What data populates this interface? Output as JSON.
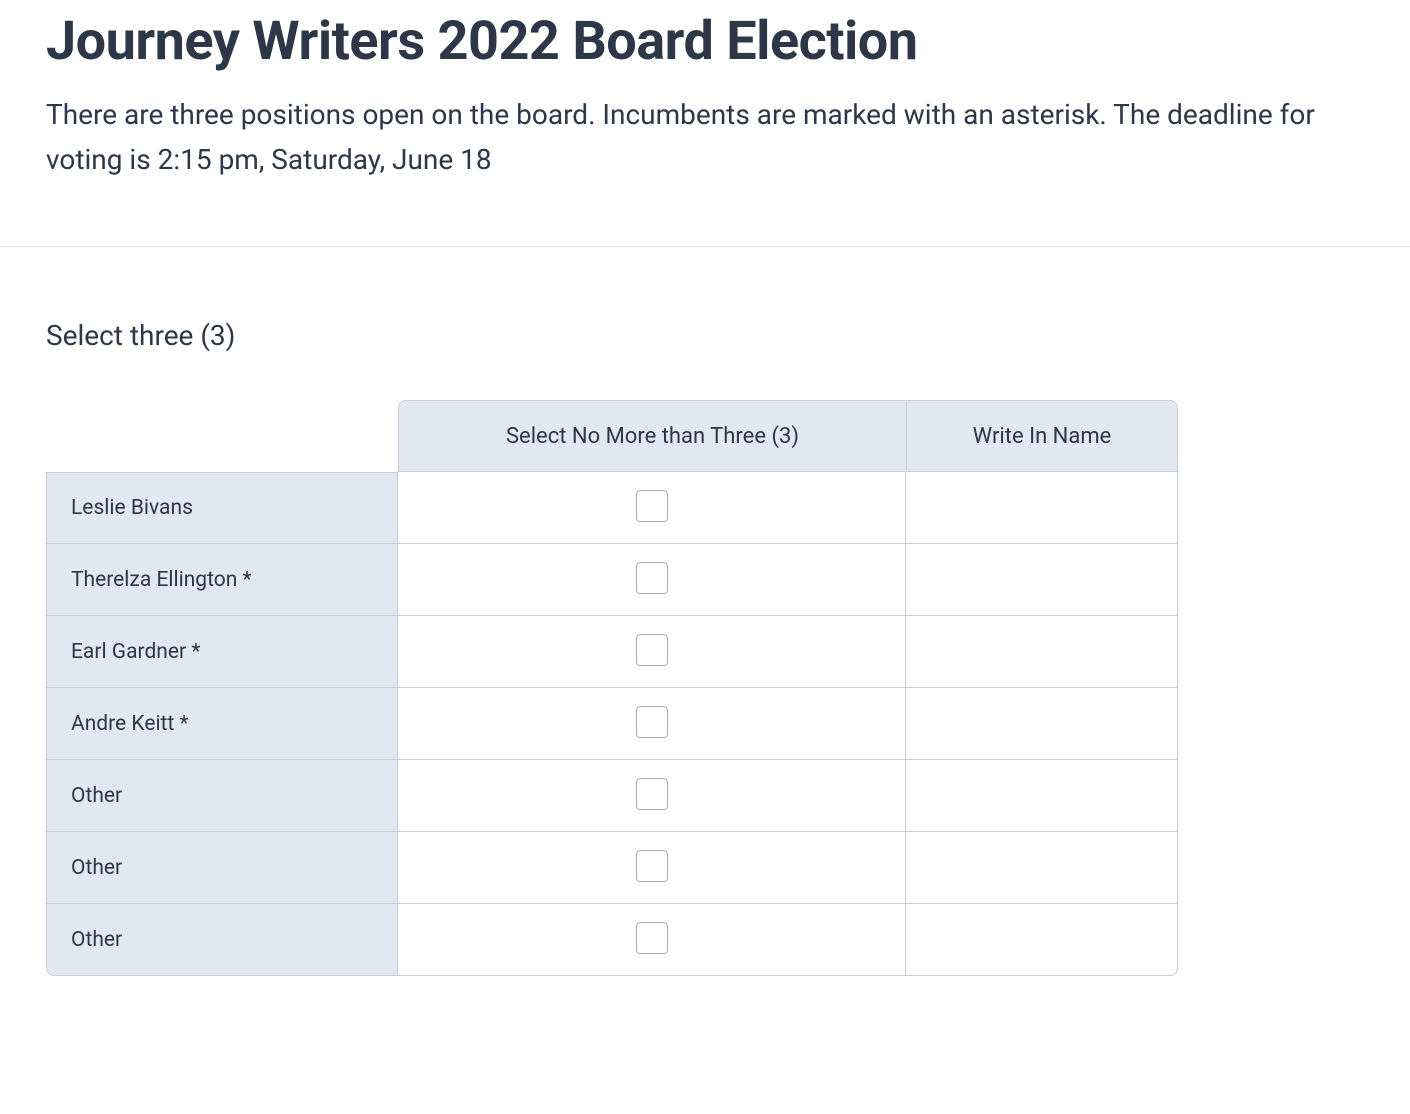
{
  "header": {
    "title": "Journey Writers 2022 Board Election",
    "description": "There are three positions open on the board. Incumbents are marked with an asterisk. The deadline for voting is 2:15 pm, Saturday, June 18"
  },
  "form": {
    "instruction": "Select three (3)",
    "columns": {
      "select": "Select No More than Three (3)",
      "writein": "Write In Name"
    },
    "rows": [
      {
        "label": "Leslie Bivans",
        "checked": false,
        "writein": ""
      },
      {
        "label": "Therelza Ellington *",
        "checked": false,
        "writein": ""
      },
      {
        "label": "Earl Gardner *",
        "checked": false,
        "writein": ""
      },
      {
        "label": "Andre Keitt *",
        "checked": false,
        "writein": ""
      },
      {
        "label": "Other",
        "checked": false,
        "writein": ""
      },
      {
        "label": "Other",
        "checked": false,
        "writein": ""
      },
      {
        "label": "Other",
        "checked": false,
        "writein": ""
      }
    ]
  }
}
